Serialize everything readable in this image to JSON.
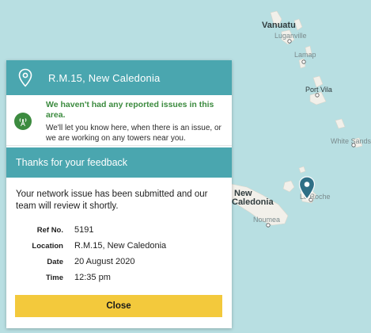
{
  "map": {
    "labels": {
      "vanuatu": "Vanuatu",
      "luganville": "Luganville",
      "lamap": "Lamap",
      "port_vila": "Port Vila",
      "white_sands": "White Sands",
      "new": "New",
      "caledonia": "Caledonia",
      "noumea": "Noumea",
      "la_roche": "La Roche"
    },
    "marker_color": "#2f6f86"
  },
  "location": {
    "title": "R.M.15, New Caledonia",
    "icon": "location-pin-icon"
  },
  "status": {
    "icon": "tower-icon",
    "title": "We haven't had any reported issues in this area.",
    "body": "We'll let you know here, when there is an issue, or we are working on any towers near you."
  },
  "feedback": {
    "header": "Thanks for your feedback",
    "message": "Your network issue has been submitted and our team will review it shortly.",
    "details": [
      {
        "label": "Ref No.",
        "value": "5191"
      },
      {
        "label": "Location",
        "value": "R.M.15, New Caledonia"
      },
      {
        "label": "Date",
        "value": "20 August 2020"
      },
      {
        "label": "Time",
        "value": "12:35 pm"
      }
    ]
  },
  "actions": {
    "close_label": "Close"
  },
  "colors": {
    "header_teal": "#4aa6af",
    "status_green": "#3c8b3f",
    "button_yellow": "#f3c93c",
    "sea": "#b8dfe2",
    "land": "#f2f0ea"
  }
}
